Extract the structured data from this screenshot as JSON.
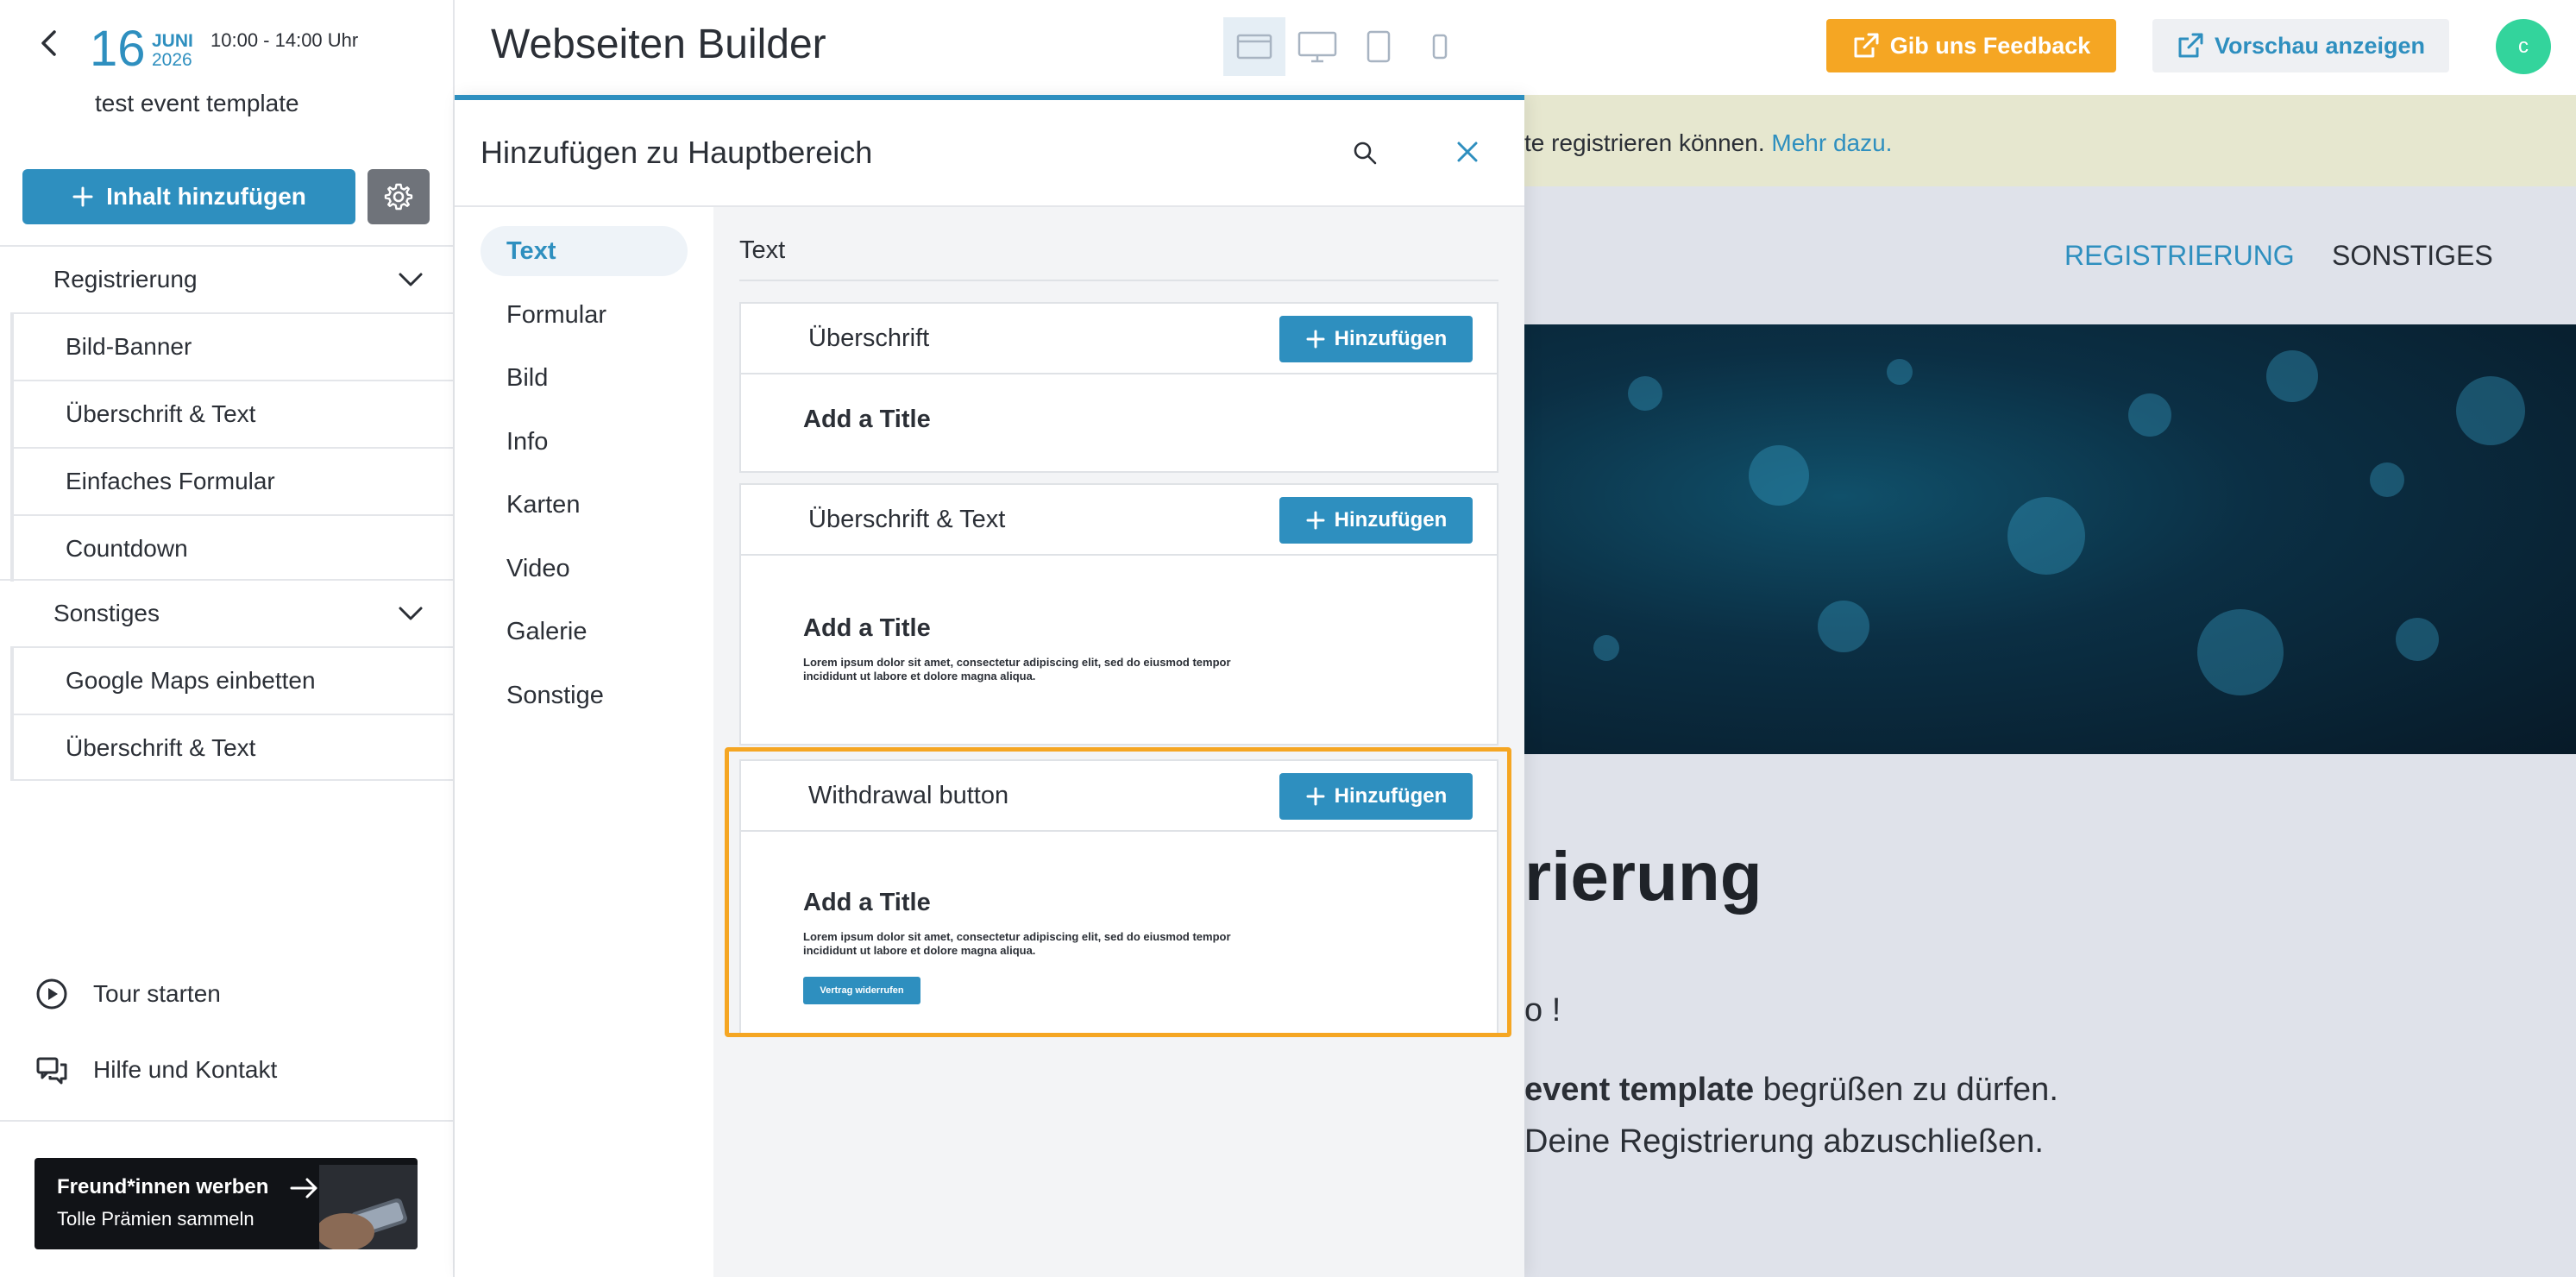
{
  "sidebar": {
    "date": {
      "day": "16",
      "month": "JUNI",
      "year": "2026",
      "time": "10:00 - 14:00 Uhr"
    },
    "event_name": "test event template",
    "add_content_label": "Inhalt hinzufügen",
    "groups": [
      {
        "label": "Registrierung",
        "items": [
          "Bild-Banner",
          "Überschrift & Text",
          "Einfaches Formular",
          "Countdown"
        ]
      },
      {
        "label": "Sonstiges",
        "items": [
          "Google Maps einbetten",
          "Überschrift & Text"
        ]
      }
    ],
    "tour_label": "Tour starten",
    "help_label": "Hilfe und Kontakt",
    "promo": {
      "title": "Freund*innen werben",
      "subtitle": "Tolle Prämien sammeln"
    }
  },
  "topbar": {
    "title": "Webseiten Builder",
    "feedback_label": "Gib uns Feedback",
    "preview_label": "Vorschau anzeigen",
    "avatar_initial": "c"
  },
  "preview": {
    "notice_text": "te registrieren können.",
    "notice_link": "Mehr dazu.",
    "nav": [
      "REGISTRIERUNG",
      "SONSTIGES"
    ],
    "heading_fragment": "rierung",
    "greeting_fragment": "o  !",
    "para1_bold": "event template",
    "para1_rest": " begrüßen zu dürfen.",
    "para2": "Deine Registrierung abzuschließen."
  },
  "modal": {
    "title": "Hinzufügen zu Hauptbereich",
    "categories": [
      "Text",
      "Formular",
      "Bild",
      "Info",
      "Karten",
      "Video",
      "Galerie",
      "Sonstige"
    ],
    "active_category": "Text",
    "section_label": "Text",
    "add_label": "Hinzufügen",
    "blocks": [
      {
        "name": "Überschrift",
        "preview_title": "Add a Title"
      },
      {
        "name": "Überschrift & Text",
        "preview_title": "Add a Title",
        "preview_text": "Lorem ipsum dolor sit amet, consectetur adipiscing elit, sed do eiusmod tempor incididunt ut labore et dolore magna aliqua."
      },
      {
        "name": "Withdrawal button",
        "preview_title": "Add a Title",
        "preview_text": "Lorem ipsum dolor sit amet, consectetur adipiscing elit, sed do eiusmod tempor incididunt ut labore et dolore magna aliqua.",
        "preview_button": "Vertrag widerrufen"
      }
    ]
  },
  "colors": {
    "accent": "#2e8fbf",
    "feedback": "#f5a623",
    "avatar": "#33d49c",
    "highlight": "#f5a623"
  }
}
